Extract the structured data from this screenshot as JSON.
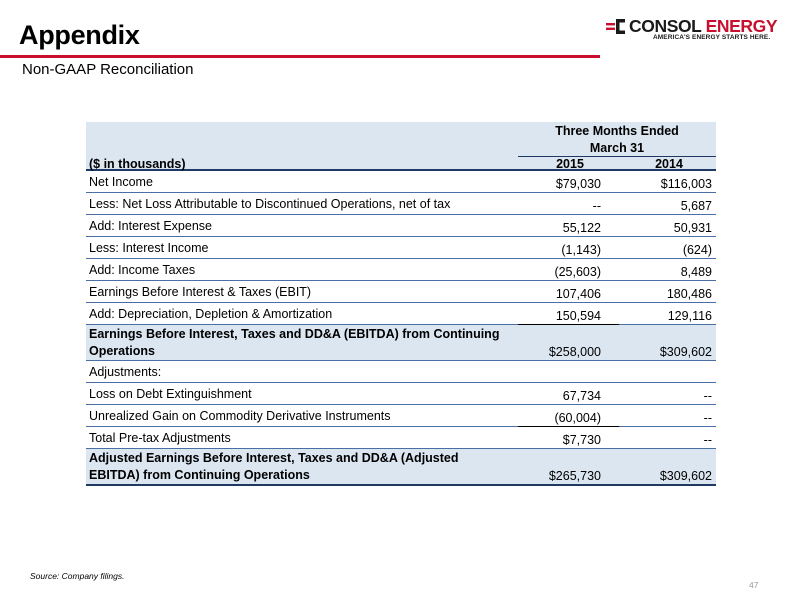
{
  "header": {
    "title": "Appendix",
    "subtitle": "Non-GAAP Reconciliation"
  },
  "logo": {
    "name_part1": "CONSOL",
    "name_part2": "ENERGY",
    "tagline": "AMERICA'S ENERGY STARTS HERE."
  },
  "table": {
    "period_header_line1": "Three Months Ended",
    "period_header_line2": "March 31",
    "units_label": "($ in thousands)",
    "col_2015": "2015",
    "col_2014": "2014",
    "rows": [
      {
        "label": "Net Income",
        "v2015": "$79,030",
        "v2014": "$116,003"
      },
      {
        "label": "Less: Net Loss Attributable to Discontinued Operations, net of tax",
        "v2015": "--",
        "v2014": "5,687"
      },
      {
        "label": "Add: Interest Expense",
        "v2015": "55,122",
        "v2014": "50,931"
      },
      {
        "label": "Less: Interest Income",
        "v2015": "(1,143)",
        "v2014": "(624)"
      },
      {
        "label": "Add: Income Taxes",
        "v2015": "(25,603)",
        "v2014": "8,489"
      },
      {
        "label": "Earnings Before Interest & Taxes (EBIT)",
        "v2015": "107,406",
        "v2014": "180,486"
      },
      {
        "label": "Add: Depreciation, Depletion & Amortization",
        "v2015": "150,594",
        "v2014": "129,116"
      },
      {
        "label": "Earnings Before Interest, Taxes and DD&A (EBITDA) from Continuing Operations",
        "v2015": "$258,000",
        "v2014": "$309,602"
      },
      {
        "label": "Adjustments:",
        "v2015": "",
        "v2014": ""
      },
      {
        "label": "Loss on Debt Extinguishment",
        "v2015": "67,734",
        "v2014": "--"
      },
      {
        "label": "Unrealized Gain on Commodity Derivative Instruments",
        "v2015": "(60,004)",
        "v2014": "--"
      },
      {
        "label": "Total Pre-tax Adjustments",
        "v2015": "$7,730",
        "v2014": "--"
      },
      {
        "label": "Adjusted Earnings Before Interest, Taxes and DD&A (Adjusted EBITDA) from Continuing Operations",
        "v2015": "$265,730",
        "v2014": "$309,602"
      }
    ]
  },
  "footer": {
    "source": "Source:  Company filings.",
    "page_number": "47"
  }
}
